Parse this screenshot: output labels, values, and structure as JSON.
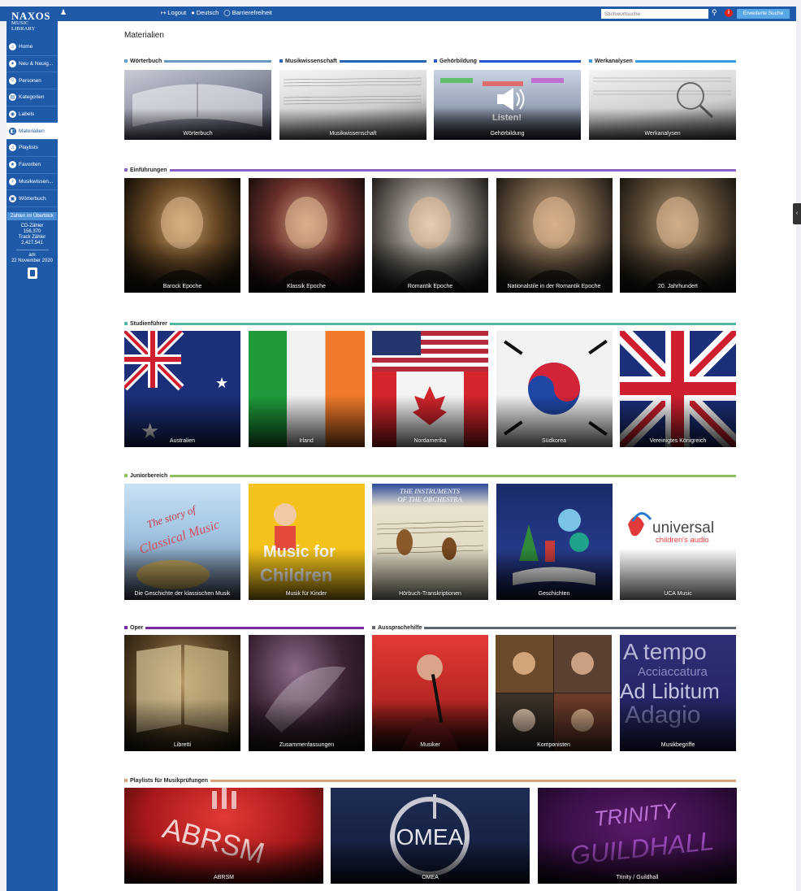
{
  "header": {
    "logo_line1": "NAXOS",
    "logo_line2": "MUSIC LIBRARY",
    "links": [
      {
        "icon": "logout-icon",
        "label": "Logout"
      },
      {
        "icon": "language-icon",
        "label": "Deutsch"
      },
      {
        "icon": "accessibility-icon",
        "label": "Barrierefreiheit"
      }
    ],
    "search_placeholder": "Stichwortsuche",
    "extended_search": "Erweiterte Suche"
  },
  "sidebar": {
    "items": [
      {
        "label": "Home",
        "active": false
      },
      {
        "label": "Neu & Neuig...",
        "active": false
      },
      {
        "label": "Personen",
        "active": false
      },
      {
        "label": "Kategorien",
        "active": false
      },
      {
        "label": "Labels",
        "active": false
      },
      {
        "label": "Materialien",
        "active": true
      },
      {
        "label": "Playlists",
        "active": false
      },
      {
        "label": "Favoriten",
        "active": false
      },
      {
        "label": "Musikwissen...",
        "active": false
      },
      {
        "label": "Wörterbuch",
        "active": false
      }
    ],
    "stats_button": "Zahlen im Überblick",
    "cd_label": "CD-Zähler",
    "cd_count": "156,370",
    "track_label": "Track Zähler",
    "track_count": "2,427,541",
    "date_label": "am",
    "date_value": "22 November 2020"
  },
  "page_title": "Materialien",
  "sections": {
    "woerterbuch": {
      "title": "Wörterbuch",
      "color": "#6a9ac6",
      "tiles": [
        "Wörterbuch"
      ]
    },
    "musikwissenschaft": {
      "title": "Musikwissenschaft",
      "color": "#2b63b3",
      "tiles": [
        "Musikwissenschaft"
      ]
    },
    "gehoerbildung": {
      "title": "Gehörbildung",
      "color": "#2956d6",
      "tiles": [
        "Gehörbildung"
      ],
      "overlay": "Listen!"
    },
    "werkanalysen": {
      "title": "Werkanalysen",
      "color": "#3b9ae0",
      "tiles": [
        "Werkanalysen"
      ]
    },
    "einfuehrungen": {
      "title": "Einführungen",
      "color": "#8a63c8",
      "tiles": [
        "Barock Epoche",
        "Klassik Epoche",
        "Romantik Epoche",
        "Nationalstile in der Romantik Epoche",
        "20. Jahrhundert"
      ]
    },
    "studienfuehrer": {
      "title": "Studienführer",
      "color": "#4fb8a4",
      "tiles": [
        "Australien",
        "Irland",
        "Nordamerika",
        "Südkorea",
        "Vereinigtes Königreich"
      ]
    },
    "juniorbereich": {
      "title": "Juniorbereich",
      "color": "#8dc05c",
      "tiles": [
        "Die Geschichte der klassischen Musik",
        "Musik für Kinder",
        "Hörbuch-Transkriptionen",
        "Geschichten",
        "UCA Music"
      ]
    },
    "oper": {
      "title": "Oper",
      "color": "#7a2aa0",
      "tiles": [
        "Libretti",
        "Zusammenfassungen"
      ]
    },
    "aussprachehilfe": {
      "title": "Aussprachehilfe",
      "color": "#5f6470",
      "tiles": [
        "Musiker",
        "Komponisten",
        "Musikbegriffe"
      ]
    },
    "playlists": {
      "title": "Playlists für Musikprüfungen",
      "color": "#d9a27a",
      "tiles": [
        "ABRSM",
        "OMEA",
        "Trinity / Guildhall"
      ]
    }
  },
  "tile_art": {
    "story_line1": "The story of",
    "story_line2": "Classical Music",
    "kinder_line1": "Music for",
    "kinder_line2": "Children",
    "instr_line1": "THE INSTRUMENTS",
    "instr_line2": "OF THE ORCHESTRA",
    "uca_line1": "universal",
    "uca_line2": "children's audio",
    "tempo_1": "A tempo",
    "tempo_2": "Acciaccatura",
    "tempo_3": "Ad Libitum",
    "tempo_4": "Adagio",
    "abrsm": "ABRSM",
    "omea": "OMEA",
    "trinity_1": "TRINITY",
    "trinity_2": "GUILDHALL"
  }
}
